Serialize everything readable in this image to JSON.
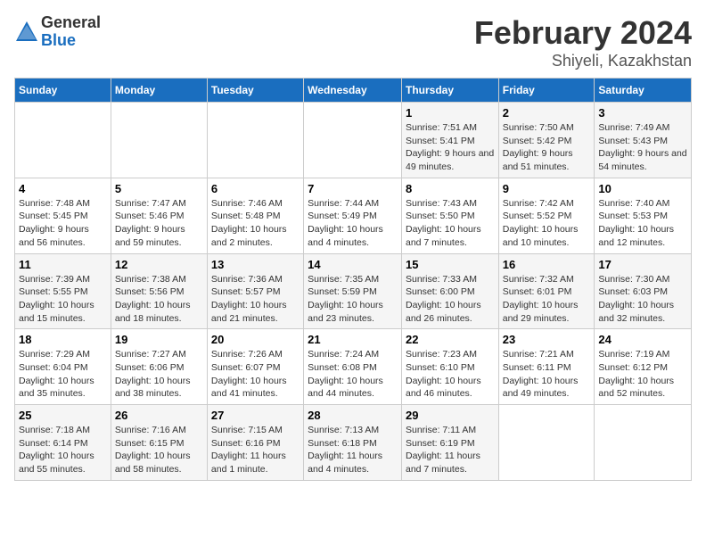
{
  "logo": {
    "general": "General",
    "blue": "Blue"
  },
  "title": {
    "month": "February 2024",
    "location": "Shiyeli, Kazakhstan"
  },
  "days_of_week": [
    "Sunday",
    "Monday",
    "Tuesday",
    "Wednesday",
    "Thursday",
    "Friday",
    "Saturday"
  ],
  "weeks": [
    [
      {
        "day": "",
        "info": ""
      },
      {
        "day": "",
        "info": ""
      },
      {
        "day": "",
        "info": ""
      },
      {
        "day": "",
        "info": ""
      },
      {
        "day": "1",
        "info": "Sunrise: 7:51 AM\nSunset: 5:41 PM\nDaylight: 9 hours and 49 minutes."
      },
      {
        "day": "2",
        "info": "Sunrise: 7:50 AM\nSunset: 5:42 PM\nDaylight: 9 hours and 51 minutes."
      },
      {
        "day": "3",
        "info": "Sunrise: 7:49 AM\nSunset: 5:43 PM\nDaylight: 9 hours and 54 minutes."
      }
    ],
    [
      {
        "day": "4",
        "info": "Sunrise: 7:48 AM\nSunset: 5:45 PM\nDaylight: 9 hours and 56 minutes."
      },
      {
        "day": "5",
        "info": "Sunrise: 7:47 AM\nSunset: 5:46 PM\nDaylight: 9 hours and 59 minutes."
      },
      {
        "day": "6",
        "info": "Sunrise: 7:46 AM\nSunset: 5:48 PM\nDaylight: 10 hours and 2 minutes."
      },
      {
        "day": "7",
        "info": "Sunrise: 7:44 AM\nSunset: 5:49 PM\nDaylight: 10 hours and 4 minutes."
      },
      {
        "day": "8",
        "info": "Sunrise: 7:43 AM\nSunset: 5:50 PM\nDaylight: 10 hours and 7 minutes."
      },
      {
        "day": "9",
        "info": "Sunrise: 7:42 AM\nSunset: 5:52 PM\nDaylight: 10 hours and 10 minutes."
      },
      {
        "day": "10",
        "info": "Sunrise: 7:40 AM\nSunset: 5:53 PM\nDaylight: 10 hours and 12 minutes."
      }
    ],
    [
      {
        "day": "11",
        "info": "Sunrise: 7:39 AM\nSunset: 5:55 PM\nDaylight: 10 hours and 15 minutes."
      },
      {
        "day": "12",
        "info": "Sunrise: 7:38 AM\nSunset: 5:56 PM\nDaylight: 10 hours and 18 minutes."
      },
      {
        "day": "13",
        "info": "Sunrise: 7:36 AM\nSunset: 5:57 PM\nDaylight: 10 hours and 21 minutes."
      },
      {
        "day": "14",
        "info": "Sunrise: 7:35 AM\nSunset: 5:59 PM\nDaylight: 10 hours and 23 minutes."
      },
      {
        "day": "15",
        "info": "Sunrise: 7:33 AM\nSunset: 6:00 PM\nDaylight: 10 hours and 26 minutes."
      },
      {
        "day": "16",
        "info": "Sunrise: 7:32 AM\nSunset: 6:01 PM\nDaylight: 10 hours and 29 minutes."
      },
      {
        "day": "17",
        "info": "Sunrise: 7:30 AM\nSunset: 6:03 PM\nDaylight: 10 hours and 32 minutes."
      }
    ],
    [
      {
        "day": "18",
        "info": "Sunrise: 7:29 AM\nSunset: 6:04 PM\nDaylight: 10 hours and 35 minutes."
      },
      {
        "day": "19",
        "info": "Sunrise: 7:27 AM\nSunset: 6:06 PM\nDaylight: 10 hours and 38 minutes."
      },
      {
        "day": "20",
        "info": "Sunrise: 7:26 AM\nSunset: 6:07 PM\nDaylight: 10 hours and 41 minutes."
      },
      {
        "day": "21",
        "info": "Sunrise: 7:24 AM\nSunset: 6:08 PM\nDaylight: 10 hours and 44 minutes."
      },
      {
        "day": "22",
        "info": "Sunrise: 7:23 AM\nSunset: 6:10 PM\nDaylight: 10 hours and 46 minutes."
      },
      {
        "day": "23",
        "info": "Sunrise: 7:21 AM\nSunset: 6:11 PM\nDaylight: 10 hours and 49 minutes."
      },
      {
        "day": "24",
        "info": "Sunrise: 7:19 AM\nSunset: 6:12 PM\nDaylight: 10 hours and 52 minutes."
      }
    ],
    [
      {
        "day": "25",
        "info": "Sunrise: 7:18 AM\nSunset: 6:14 PM\nDaylight: 10 hours and 55 minutes."
      },
      {
        "day": "26",
        "info": "Sunrise: 7:16 AM\nSunset: 6:15 PM\nDaylight: 10 hours and 58 minutes."
      },
      {
        "day": "27",
        "info": "Sunrise: 7:15 AM\nSunset: 6:16 PM\nDaylight: 11 hours and 1 minute."
      },
      {
        "day": "28",
        "info": "Sunrise: 7:13 AM\nSunset: 6:18 PM\nDaylight: 11 hours and 4 minutes."
      },
      {
        "day": "29",
        "info": "Sunrise: 7:11 AM\nSunset: 6:19 PM\nDaylight: 11 hours and 7 minutes."
      },
      {
        "day": "",
        "info": ""
      },
      {
        "day": "",
        "info": ""
      }
    ]
  ]
}
